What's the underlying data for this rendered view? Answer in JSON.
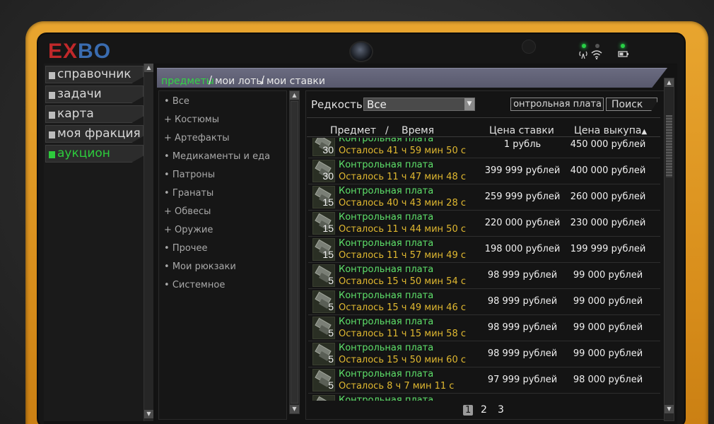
{
  "logo": {
    "part1": "EX",
    "part2": "BO"
  },
  "nav": {
    "items": [
      {
        "label": "справочник",
        "active": false
      },
      {
        "label": "задачи",
        "active": false
      },
      {
        "label": "карта",
        "active": false
      },
      {
        "label": "моя фракция",
        "active": false
      },
      {
        "label": "аукцион",
        "active": true
      }
    ]
  },
  "tabs": {
    "items": [
      "предметы",
      "мои лоты",
      "мои ставки"
    ],
    "active": "предметы",
    "separator": "/"
  },
  "categories": [
    {
      "prefix": "•",
      "label": "Все"
    },
    {
      "prefix": "+",
      "label": "Костюмы"
    },
    {
      "prefix": "+",
      "label": "Артефакты"
    },
    {
      "prefix": "•",
      "label": "Медикаменты и еда"
    },
    {
      "prefix": "•",
      "label": "Патроны"
    },
    {
      "prefix": "•",
      "label": "Гранаты"
    },
    {
      "prefix": "+",
      "label": "Обвесы"
    },
    {
      "prefix": "+",
      "label": "Оружие"
    },
    {
      "prefix": "•",
      "label": "Прочее"
    },
    {
      "prefix": "•",
      "label": "Мои рюкзаки"
    },
    {
      "prefix": "•",
      "label": "Системное"
    }
  ],
  "filters": {
    "rarity_label": "Редкость",
    "rarity_value": "Все",
    "search_value": "онтрольная плата",
    "search_button": "Поиск"
  },
  "columns": {
    "item": "Предмет",
    "slash": "/",
    "time": "Время",
    "bid": "Цена ставки",
    "buyout": "Цена выкупа",
    "sort_indicator": "▲"
  },
  "rows": [
    {
      "qty": "30",
      "name": "Контрольная плата",
      "time": "Осталось 41 ч 59 мин 50 с",
      "bid": "1 рубль",
      "buyout": "450 000 рублей"
    },
    {
      "qty": "30",
      "name": "Контрольная плата",
      "time": "Осталось 11 ч 47 мин 48 с",
      "bid": "399 999 рублей",
      "buyout": "400 000 рублей"
    },
    {
      "qty": "15",
      "name": "Контрольная плата",
      "time": "Осталось 40 ч 43 мин 28 с",
      "bid": "259 999 рублей",
      "buyout": "260 000 рублей"
    },
    {
      "qty": "15",
      "name": "Контрольная плата",
      "time": "Осталось 11 ч 44 мин 50 с",
      "bid": "220 000 рублей",
      "buyout": "230 000 рублей"
    },
    {
      "qty": "15",
      "name": "Контрольная плата",
      "time": "Осталось 11 ч 57 мин 49 с",
      "bid": "198 000 рублей",
      "buyout": "199 999 рублей"
    },
    {
      "qty": "5",
      "name": "Контрольная плата",
      "time": "Осталось 15 ч 50 мин 54 с",
      "bid": "98 999 рублей",
      "buyout": "99 000 рублей"
    },
    {
      "qty": "5",
      "name": "Контрольная плата",
      "time": "Осталось 15 ч 49 мин 46 с",
      "bid": "98 999 рублей",
      "buyout": "99 000 рублей"
    },
    {
      "qty": "5",
      "name": "Контрольная плата",
      "time": "Осталось 11 ч 15 мин 58 с",
      "bid": "98 999 рублей",
      "buyout": "99 000 рублей"
    },
    {
      "qty": "5",
      "name": "Контрольная плата",
      "time": "Осталось 15 ч 50 мин 60 с",
      "bid": "98 999 рублей",
      "buyout": "99 000 рублей"
    },
    {
      "qty": "5",
      "name": "Контрольная плата",
      "time": "Осталось 8 ч 7 мин 11 с",
      "bid": "97 999 рублей",
      "buyout": "98 000 рублей"
    },
    {
      "qty": "",
      "name": "Контрольная плата",
      "time": "",
      "bid": "",
      "buyout": ""
    }
  ],
  "pagination": {
    "pages": [
      "1",
      "2",
      "3"
    ],
    "current": "1"
  },
  "icons": {
    "scroll_up": "▲",
    "scroll_down": "▼",
    "dropdown": "▼",
    "signal": "signal-icon",
    "wifi": "wifi-icon",
    "battery": "battery-icon"
  },
  "colors": {
    "accent_green": "#2dcc3c",
    "time_yellow": "#e0b830",
    "frame_orange": "#e8a52f"
  }
}
